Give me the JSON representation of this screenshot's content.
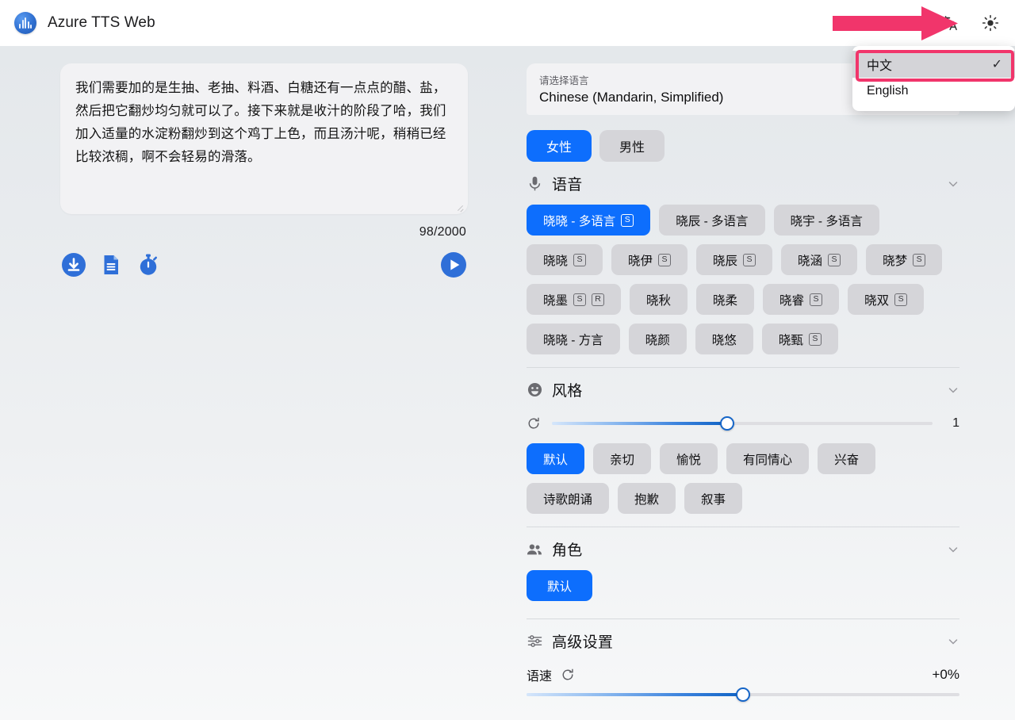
{
  "header": {
    "app_title": "Azure TTS Web",
    "logo_icon": "waveform-logo-icon",
    "translate_icon": "translate-icon",
    "theme_icon": "sun-icon"
  },
  "language_menu": {
    "items": [
      {
        "label": "中文",
        "selected": true,
        "check": "✓"
      },
      {
        "label": "English",
        "selected": false,
        "check": ""
      }
    ]
  },
  "editor": {
    "text": "我们需要加的是生抽、老抽、料酒、白糖还有一点点的醋、盐，然后把它翻炒均匀就可以了。接下来就是收汁的阶段了哈，我们加入适量的水淀粉翻炒到这个鸡丁上色，而且汤汁呢，稍稍已经比较浓稠，啊不会轻易的滑落。",
    "char_count": "98/2000",
    "actions": [
      {
        "name": "download-icon"
      },
      {
        "name": "document-icon"
      },
      {
        "name": "stopwatch-icon"
      }
    ],
    "play_icon": "play-icon"
  },
  "language_select": {
    "label": "请选择语言",
    "value": "Chinese (Mandarin, Simplified)"
  },
  "gender": {
    "options": [
      {
        "label": "女性",
        "selected": true
      },
      {
        "label": "男性",
        "selected": false
      }
    ]
  },
  "voice_section": {
    "icon": "microphone-icon",
    "title": "语音",
    "chevron": "chevron-down-icon",
    "voices": [
      {
        "label": "晓晓 - 多语言",
        "badges": [
          "S"
        ],
        "selected": true
      },
      {
        "label": "晓辰 - 多语言",
        "badges": [],
        "selected": false
      },
      {
        "label": "晓宇 - 多语言",
        "badges": [],
        "selected": false
      },
      {
        "label": "晓晓",
        "badges": [
          "S"
        ],
        "selected": false
      },
      {
        "label": "晓伊",
        "badges": [
          "S"
        ],
        "selected": false
      },
      {
        "label": "晓辰",
        "badges": [
          "S"
        ],
        "selected": false
      },
      {
        "label": "晓涵",
        "badges": [
          "S"
        ],
        "selected": false
      },
      {
        "label": "晓梦",
        "badges": [
          "S"
        ],
        "selected": false
      },
      {
        "label": "晓墨",
        "badges": [
          "S",
          "R"
        ],
        "selected": false
      },
      {
        "label": "晓秋",
        "badges": [],
        "selected": false
      },
      {
        "label": "晓柔",
        "badges": [],
        "selected": false
      },
      {
        "label": "晓睿",
        "badges": [
          "S"
        ],
        "selected": false
      },
      {
        "label": "晓双",
        "badges": [
          "S"
        ],
        "selected": false
      },
      {
        "label": "晓晓 - 方言",
        "badges": [],
        "selected": false
      },
      {
        "label": "晓颜",
        "badges": [],
        "selected": false
      },
      {
        "label": "晓悠",
        "badges": [],
        "selected": false
      },
      {
        "label": "晓甄",
        "badges": [
          "S"
        ],
        "selected": false
      }
    ]
  },
  "style_section": {
    "icon": "smiley-icon",
    "title": "风格",
    "chevron": "chevron-down-icon",
    "reset_icon": "reset-icon",
    "slider": {
      "value": "1",
      "percent": 46
    },
    "styles": [
      {
        "label": "默认",
        "selected": true
      },
      {
        "label": "亲切",
        "selected": false
      },
      {
        "label": "愉悦",
        "selected": false
      },
      {
        "label": "有同情心",
        "selected": false
      },
      {
        "label": "兴奋",
        "selected": false
      },
      {
        "label": "诗歌朗诵",
        "selected": false
      },
      {
        "label": "抱歉",
        "selected": false
      },
      {
        "label": "叙事",
        "selected": false
      }
    ]
  },
  "role_section": {
    "icon": "people-icon",
    "title": "角色",
    "chevron": "chevron-down-icon",
    "roles": [
      {
        "label": "默认",
        "selected": true
      }
    ]
  },
  "advanced_section": {
    "icon": "sliders-icon",
    "title": "高级设置",
    "chevron": "chevron-down-icon",
    "rate": {
      "label": "语速",
      "reset_icon": "reset-icon",
      "value": "+0%",
      "percent": 50
    }
  },
  "annotations": {
    "arrow_color": "#f1356b",
    "box_color": "#f1356b"
  }
}
